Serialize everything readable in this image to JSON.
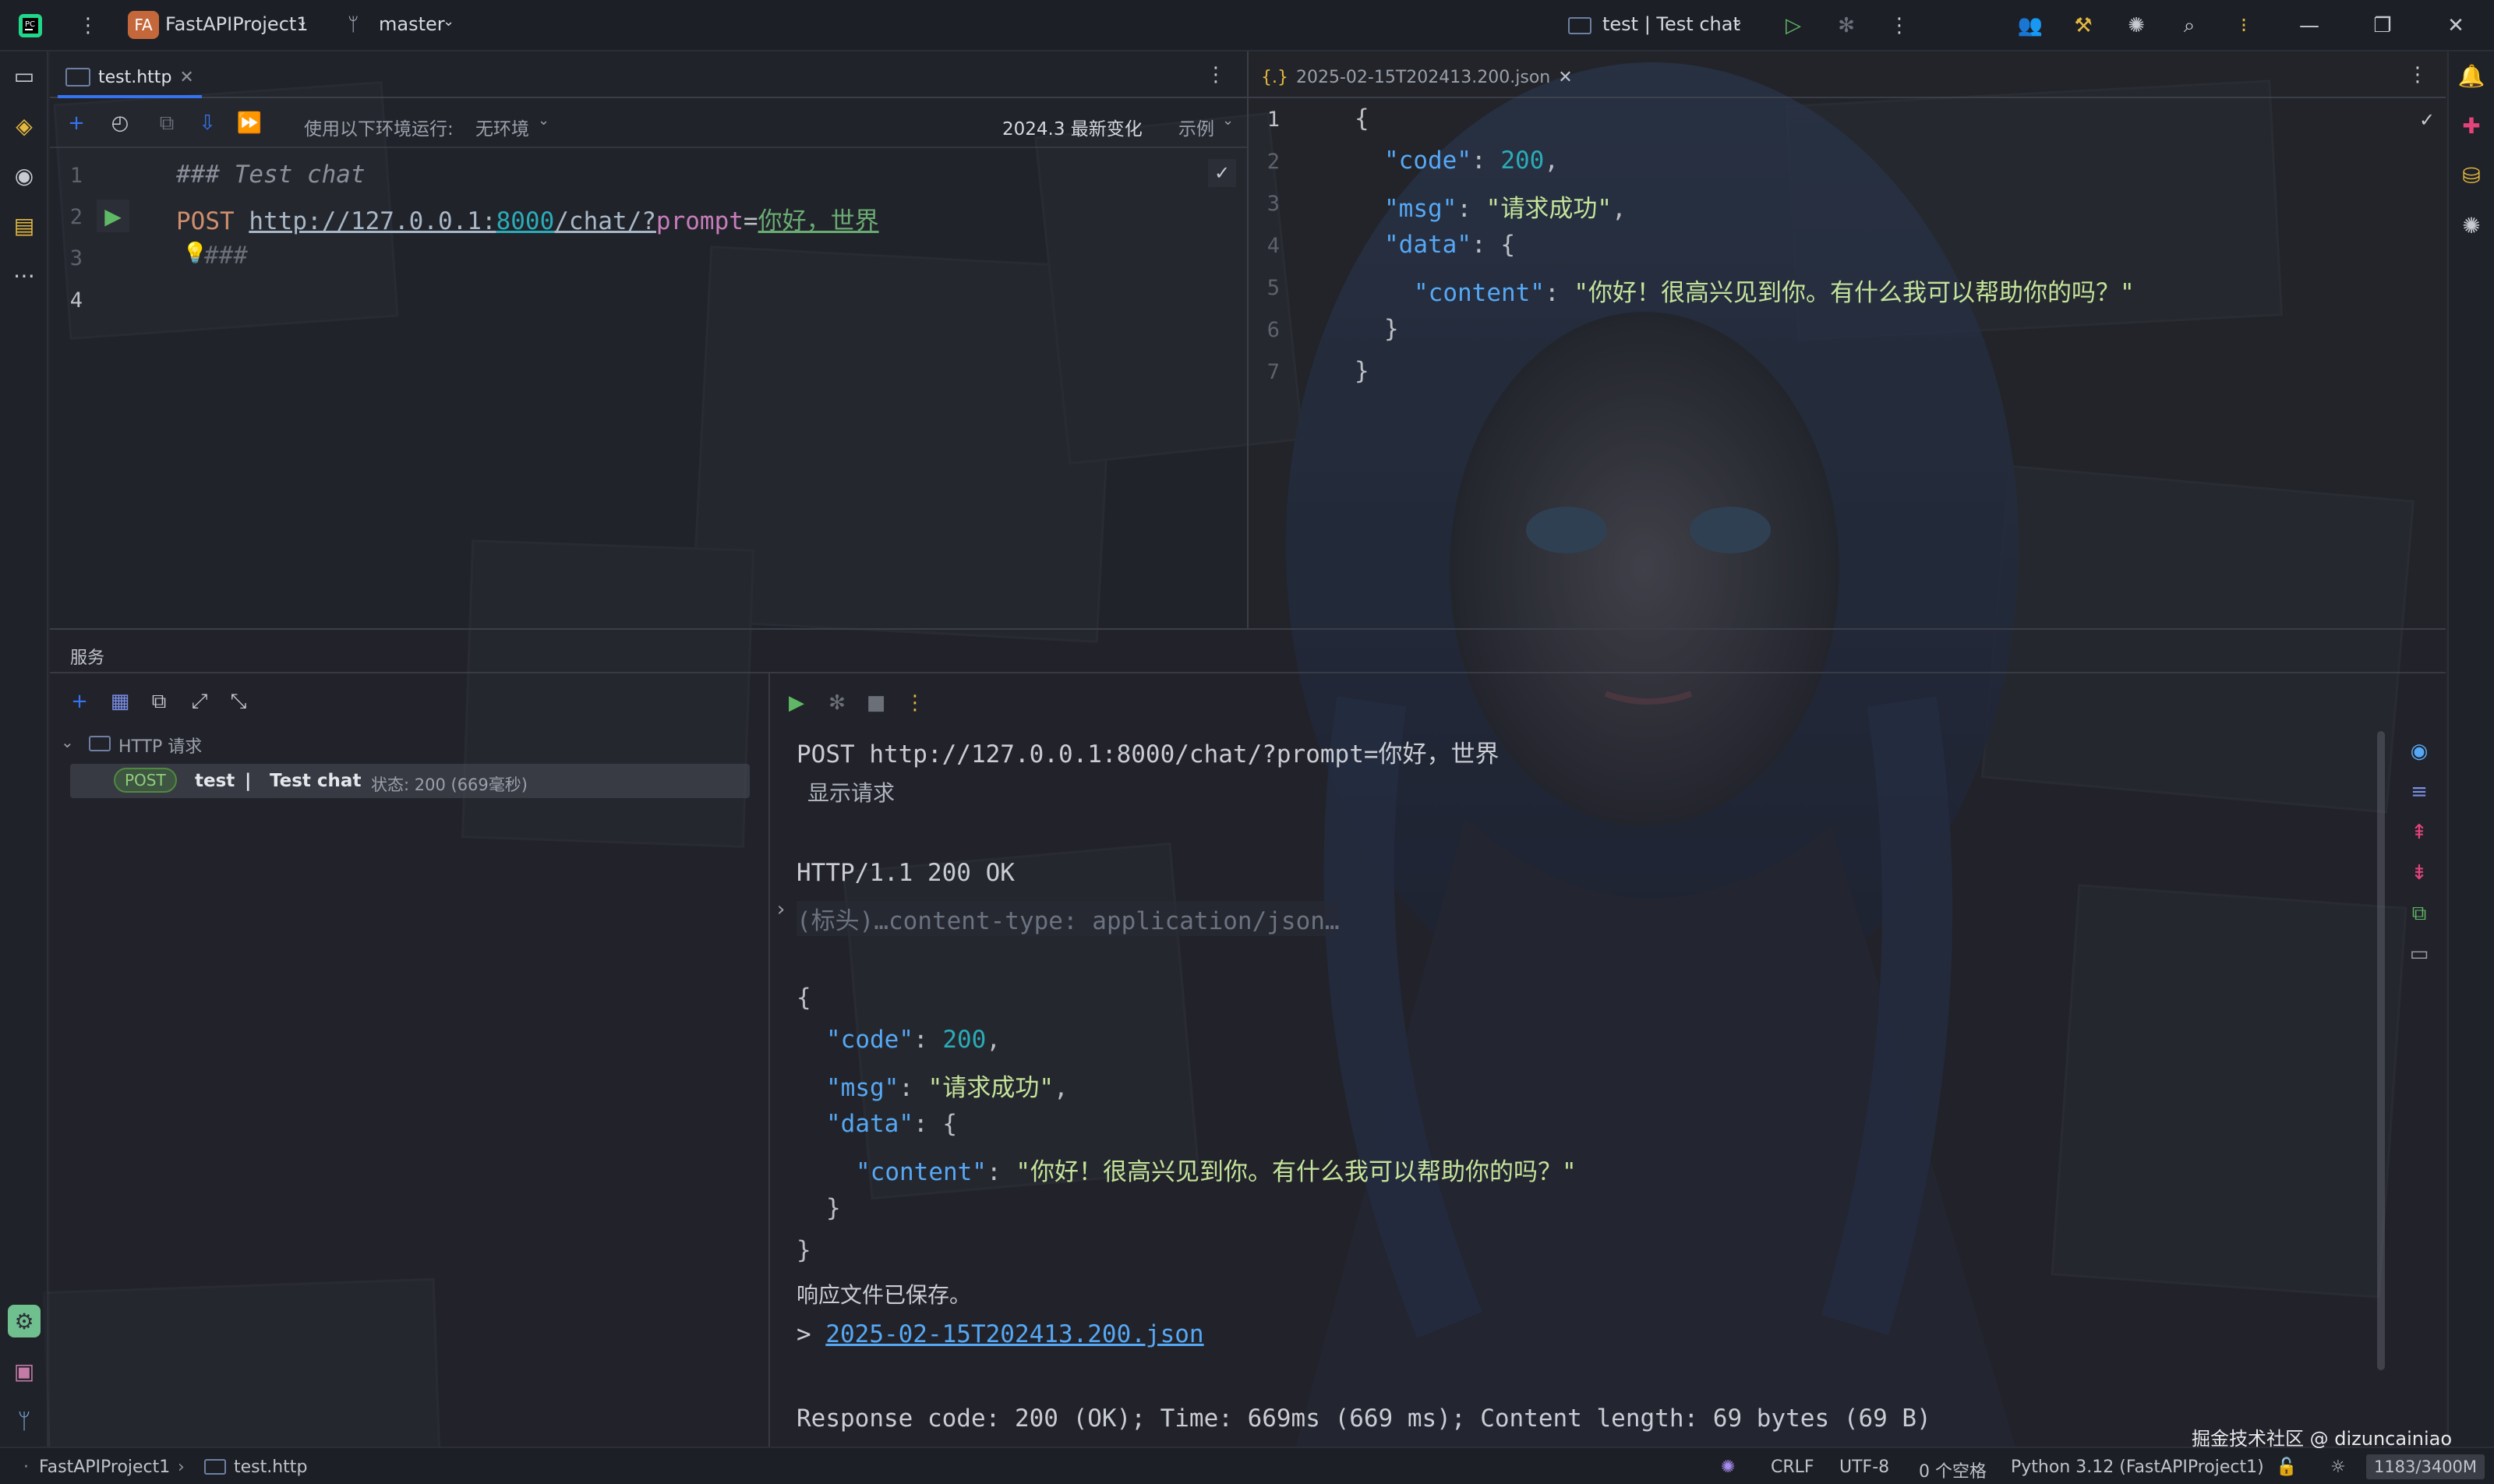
{
  "titlebar": {
    "project_badge": "FA",
    "project_name": "FastAPIProject1",
    "branch": "master",
    "run_config": "test | Test chat"
  },
  "editor": {
    "tab_label": "test.http",
    "toolbar": {
      "env_label": "使用以下环境运行:",
      "env_value": "无环境",
      "whats_new": "2024.3 最新变化",
      "examples": "示例"
    },
    "lines": [
      {
        "num": "1",
        "comment": "### Test chat"
      },
      {
        "num": "2",
        "method": "POST",
        "url_host": "http://127.0.0.1:",
        "url_port": "8000",
        "url_path": "/chat/?",
        "param": "prompt",
        "eq": "=",
        "value": "你好，世界"
      },
      {
        "num": "3",
        "text": "###"
      },
      {
        "num": "4",
        "text": ""
      }
    ]
  },
  "json_editor": {
    "tab_label": "2025-02-15T202413.200.json",
    "lines": [
      {
        "num": "1",
        "text": "{"
      },
      {
        "num": "2",
        "key": "\"code\"",
        "sep": ": ",
        "num_val": "200",
        "tail": ","
      },
      {
        "num": "3",
        "key": "\"msg\"",
        "sep": ": ",
        "str_val": "\"请求成功\"",
        "tail": ","
      },
      {
        "num": "4",
        "key": "\"data\"",
        "sep": ": ",
        "tail": "{"
      },
      {
        "num": "5",
        "key": "\"content\"",
        "sep": ": ",
        "str_val": "\"你好！很高兴见到你。有什么我可以帮助你的吗？\""
      },
      {
        "num": "6",
        "text": "}"
      },
      {
        "num": "7",
        "text": "}"
      }
    ]
  },
  "services": {
    "title": "服务",
    "group_label": "HTTP 请求",
    "item": {
      "method": "POST",
      "file": "test",
      "sep": "|",
      "name": "Test chat",
      "status": "状态: 200 (669毫秒)"
    }
  },
  "output": {
    "request_line": "POST http://127.0.0.1:8000/chat/?prompt=你好，世界",
    "show_request": "显示请求",
    "status_line": "HTTP/1.1 200 OK",
    "headers_collapsed": "(标头)…content-type: application/json…",
    "body": [
      {
        "text": "{"
      },
      {
        "key": "\"code\"",
        "sep": ": ",
        "num_val": "200",
        "tail": ","
      },
      {
        "key": "\"msg\"",
        "sep": ": ",
        "str_val": "\"请求成功\"",
        "tail": ","
      },
      {
        "key": "\"data\"",
        "sep": ": ",
        "tail": "{"
      },
      {
        "key": "\"content\"",
        "sep": ": ",
        "str_val": "\"你好！很高兴见到你。有什么我可以帮助你的吗？\""
      },
      {
        "text": "}"
      },
      {
        "text": "}"
      }
    ],
    "saved_msg": "响应文件已保存。",
    "saved_link_prefix": "> ",
    "saved_link": "2025-02-15T202413.200.json",
    "summary": "Response code: 200 (OK); Time: 669ms (669 ms); Content length: 69 bytes (69 B)"
  },
  "statusbar": {
    "breadcrumb_project": "FastAPIProject1",
    "breadcrumb_file": "test.http",
    "line_sep": "CRLF",
    "encoding": "UTF-8",
    "indent": "0 个空格",
    "interpreter": "Python 3.12 (FastAPIProject1)",
    "memory": "1183/3400M"
  },
  "watermark": "掘金技术社区 @ dizuncainiao",
  "colors": {
    "accent_blue": "#3574f0",
    "run_green": "#5fb865",
    "post_badge": "#4e8a3e"
  }
}
